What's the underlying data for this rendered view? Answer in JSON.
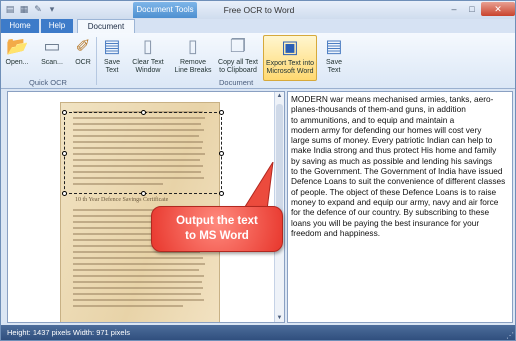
{
  "titlebar": {
    "title": "Free OCR to Word",
    "contextual_tab": "Document Tools"
  },
  "tabs": [
    {
      "label": "Home"
    },
    {
      "label": "Help"
    },
    {
      "label": "Document"
    }
  ],
  "ribbon": {
    "buttons": [
      {
        "label": "Open...",
        "icon": "folder-icon"
      },
      {
        "label": "Scan...",
        "icon": "scanner-icon"
      },
      {
        "label": "OCR",
        "icon": "wand-icon"
      },
      {
        "label": "Save\nText",
        "icon": "save-icon"
      },
      {
        "label": "Clear Text\nWindow",
        "icon": "document-icon"
      },
      {
        "label": "Remove\nLine Breaks",
        "icon": "document-icon"
      },
      {
        "label": "Copy all Text\nto Clipboard",
        "icon": "copy-icon"
      },
      {
        "label": "Export Text into\nMicrosoft Word",
        "icon": "word-icon"
      },
      {
        "label": "Save\nText",
        "icon": "save-icon"
      }
    ],
    "groups": [
      "Quick OCR",
      "Document"
    ]
  },
  "image": {
    "heading_text": "10 th Year Defence Savings Certificate"
  },
  "callout": {
    "text": "Output the text\nto MS Word"
  },
  "ocr_text": "MODERN war means mechanised armies, tanks, aero-\nplanes-thousands of them-and guns, in addition\nto ammunitions, and to equip and maintain a\nmodern army for defending our homes will cost very\nlarge sums of money. Every patriotic Indian can help to\nmake India strong and thus protect His home and family\nby saving as much as possible and lending his savings\nto the Government. The Government of India have issued\nDefence Loans to suit the convenience of different classes\nof people. The object of these Defence Loans is to raise\nmoney to expand and equip our army, navy and air force\nfor the defence of our country. By subscribing to these\nloans you will be paying the best insurance for your\nfreedom and happiness.",
  "status": {
    "text": "Height: 1437 pixels  Width: 971 pixels"
  }
}
